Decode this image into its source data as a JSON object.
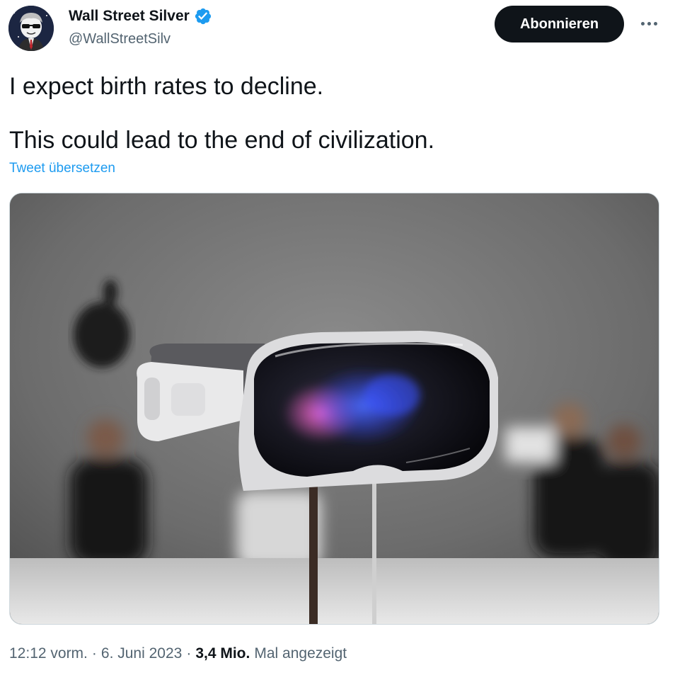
{
  "author": {
    "name": "Wall Street Silver",
    "handle": "@WallStreetSilv",
    "verified": true
  },
  "actions": {
    "subscribe_label": "Abonnieren"
  },
  "tweet": {
    "lines": [
      "I expect birth rates to decline.",
      "This could lead to the end of civilization."
    ],
    "translate_label": "Tweet übersetzen"
  },
  "meta": {
    "time": "12:12 vorm.",
    "separator": "·",
    "date": "6. Juni 2023",
    "views": "3,4 Mio.",
    "views_suffix": "Mal angezeigt"
  },
  "colors": {
    "accent": "#1d9bf0",
    "text": "#0f1419",
    "secondary": "#536471",
    "button": "#0f1419"
  }
}
